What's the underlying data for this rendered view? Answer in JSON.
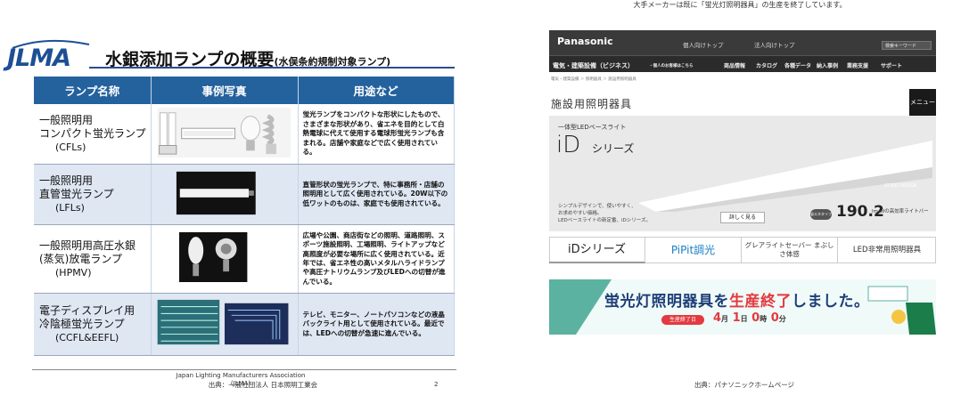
{
  "top_note": "大手メーカーは既に「蛍光灯照明器具」の生産を終了しています。",
  "left_slide": {
    "logo": "JLMA",
    "title": "水銀添加ランプの概要",
    "title_sub": "(水俣条約規制対象ランプ)",
    "headers": [
      "ランプ名称",
      "事例写真",
      "用途など"
    ],
    "rows": [
      {
        "name_lines": [
          "一般照明用",
          "コンパクト蛍光ランプ"
        ],
        "abbr": "(CFLs)",
        "desc": "蛍光ランプをコンパクトな形状にしたもので、さまざまな形状があり、省エネを目的として白熱電球に代えて使用する電球形蛍光ランプも含まれる。店舗や家庭などで広く使用されている。"
      },
      {
        "name_lines": [
          "一般照明用",
          "直管蛍光ランプ"
        ],
        "abbr": "(LFLs)",
        "desc": "直管形状の蛍光ランプで、特に事務所・店舗の照明用として広く使用されている。20W以下の低ワットのものは、家庭でも使用されている。"
      },
      {
        "name_lines": [
          "一般照明用高圧水銀",
          "(蒸気)放電ランプ"
        ],
        "abbr": "(HPMV)",
        "desc": "広場や公園、商店街などの照明、道路照明、スポーツ施設照明、工場照明、ライトアップなど高照度が必要な場所に広く使用されている。近年では、省エネ性の高いメタルハライドランプや高圧ナトリウムランプ及びLEDへの切替が進んでいる。"
      },
      {
        "name_lines": [
          "電子ディスプレイ用",
          "冷陰極蛍光ランプ"
        ],
        "abbr": "(CCFL&EEFL)",
        "desc": "テレビ、モニター、ノートパソコンなどの液晶バックライト用として使用されている。最近では、LEDへの切替が急速に進んでいる。"
      }
    ],
    "footer_org": "Japan Lighting Manufacturers Association",
    "footer_abbr": "(JLMA)",
    "page_number": "2"
  },
  "source_left": "出典：一般社団法人 日本照明工業会",
  "panasonic": {
    "logo": "Panasonic",
    "top_links": [
      "個人向けトップ",
      "法人向けトップ"
    ],
    "search_placeholder": "検索キーワード",
    "nav": [
      "電気・建築設備（ビジネス）",
      "・個人のお客様はこちら",
      "商品情報",
      "カタログ",
      "各種データ",
      "納入事例",
      "業務支援",
      "サポート"
    ],
    "breadcrumb": "電気・建築設備 ＞ 照明器具 ＞ 施設用照明器具",
    "section_title": "施設用照明器具",
    "menu_label": "メニュー",
    "banner": {
      "subtitle": "一体型LEDベースライト",
      "title_big": "iD",
      "title_small": "シリーズ",
      "copy_lines": [
        "シンプルデザインで、使いやすく、",
        "お求めやすい価格。",
        "LEDベースライトの新定番、iDシリーズ。"
      ],
      "more_button": "詳しく見る",
      "badge": "省エネタイプ",
      "efficiency_value": "190.2",
      "efficiency_unit": "lm/Wの高効率ライトバー",
      "good_design": "GOOD DESIGN"
    },
    "tabs": [
      "iDシリーズ",
      "PiPit調光",
      "グレアライトセーバー まぶしさ体感",
      "LED非常用照明器具"
    ],
    "end_banner": {
      "title_part1": "蛍光灯照明器具を",
      "title_part2": "生産終了",
      "title_part3": "しました。",
      "count_label": "生産終了日",
      "count_month": "4",
      "count_month_unit": "月",
      "count_day": "1",
      "count_day_unit": "日",
      "count_hour": "0",
      "count_hour_unit": "時",
      "count_min": "0",
      "count_min_unit": "分"
    }
  },
  "source_right": "出典：パナソニックホームページ",
  "colors": {
    "jlma_blue": "#1d4f96",
    "table_header": "#24629e",
    "row_alt": "#dfe7f3",
    "pana_dark": "#3a3a3a",
    "end_red": "#e23a40",
    "end_blue": "#1e3f78"
  }
}
